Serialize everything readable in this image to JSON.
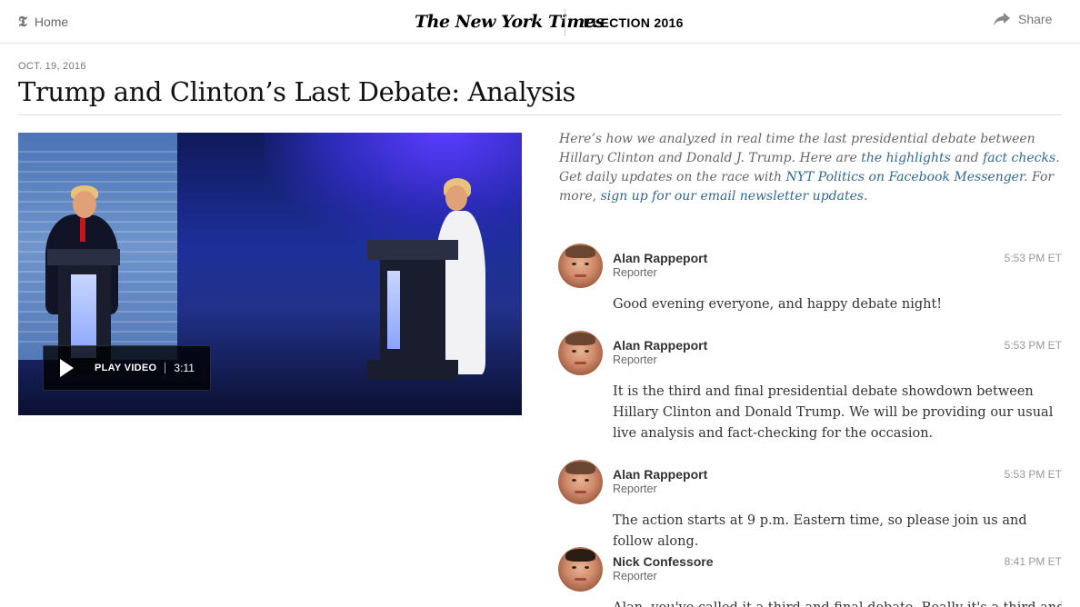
{
  "header": {
    "home_label": "Home",
    "masthead": "The New York Times",
    "section": "ELECTION 2016",
    "share_label": "Share"
  },
  "article": {
    "date": "OCT. 19, 2016",
    "headline": "Trump and Clinton’s Last Debate: Analysis"
  },
  "video": {
    "play_label": "PLAY VIDEO",
    "duration": "3:11"
  },
  "intro": {
    "part1": "Here’s how we analyzed in real time the last presidential debate between Hillary Clinton and Donald J. Trump. Here are ",
    "link1": "the highlights",
    "part2": " and ",
    "link2": "fact checks",
    "part3": ". Get daily updates on the race with ",
    "link3": "NYT Politics on Facebook Messenger",
    "part4": ". For more, ",
    "link4": "sign up for our email newsletter updates",
    "part5": "."
  },
  "posts": [
    {
      "author": "Alan Rappeport",
      "role": "Reporter",
      "time": "5:53 PM ET",
      "text": "Good evening everyone, and happy debate night!"
    },
    {
      "author": "Alan Rappeport",
      "role": "Reporter",
      "time": "5:53 PM ET",
      "text": "It is the third and final presidential debate showdown between Hillary Clinton and Donald Trump. We will be providing our usual live analysis and fact-checking for the occasion."
    },
    {
      "author": "Alan Rappeport",
      "role": "Reporter",
      "time": "5:53 PM ET",
      "text": "The action starts at 9 p.m. Eastern time, so please join us and follow along."
    },
    {
      "author": "Nick Confessore",
      "role": "Reporter",
      "time": "8:41 PM ET",
      "text": "Alan, you've called it a third and final debate. Really it's a third and final"
    }
  ],
  "icons": {
    "home": "nyt-t-icon",
    "share": "share-arrow-icon",
    "play": "play-icon"
  },
  "colors": {
    "link": "#326891",
    "meta_text": "#999999"
  }
}
